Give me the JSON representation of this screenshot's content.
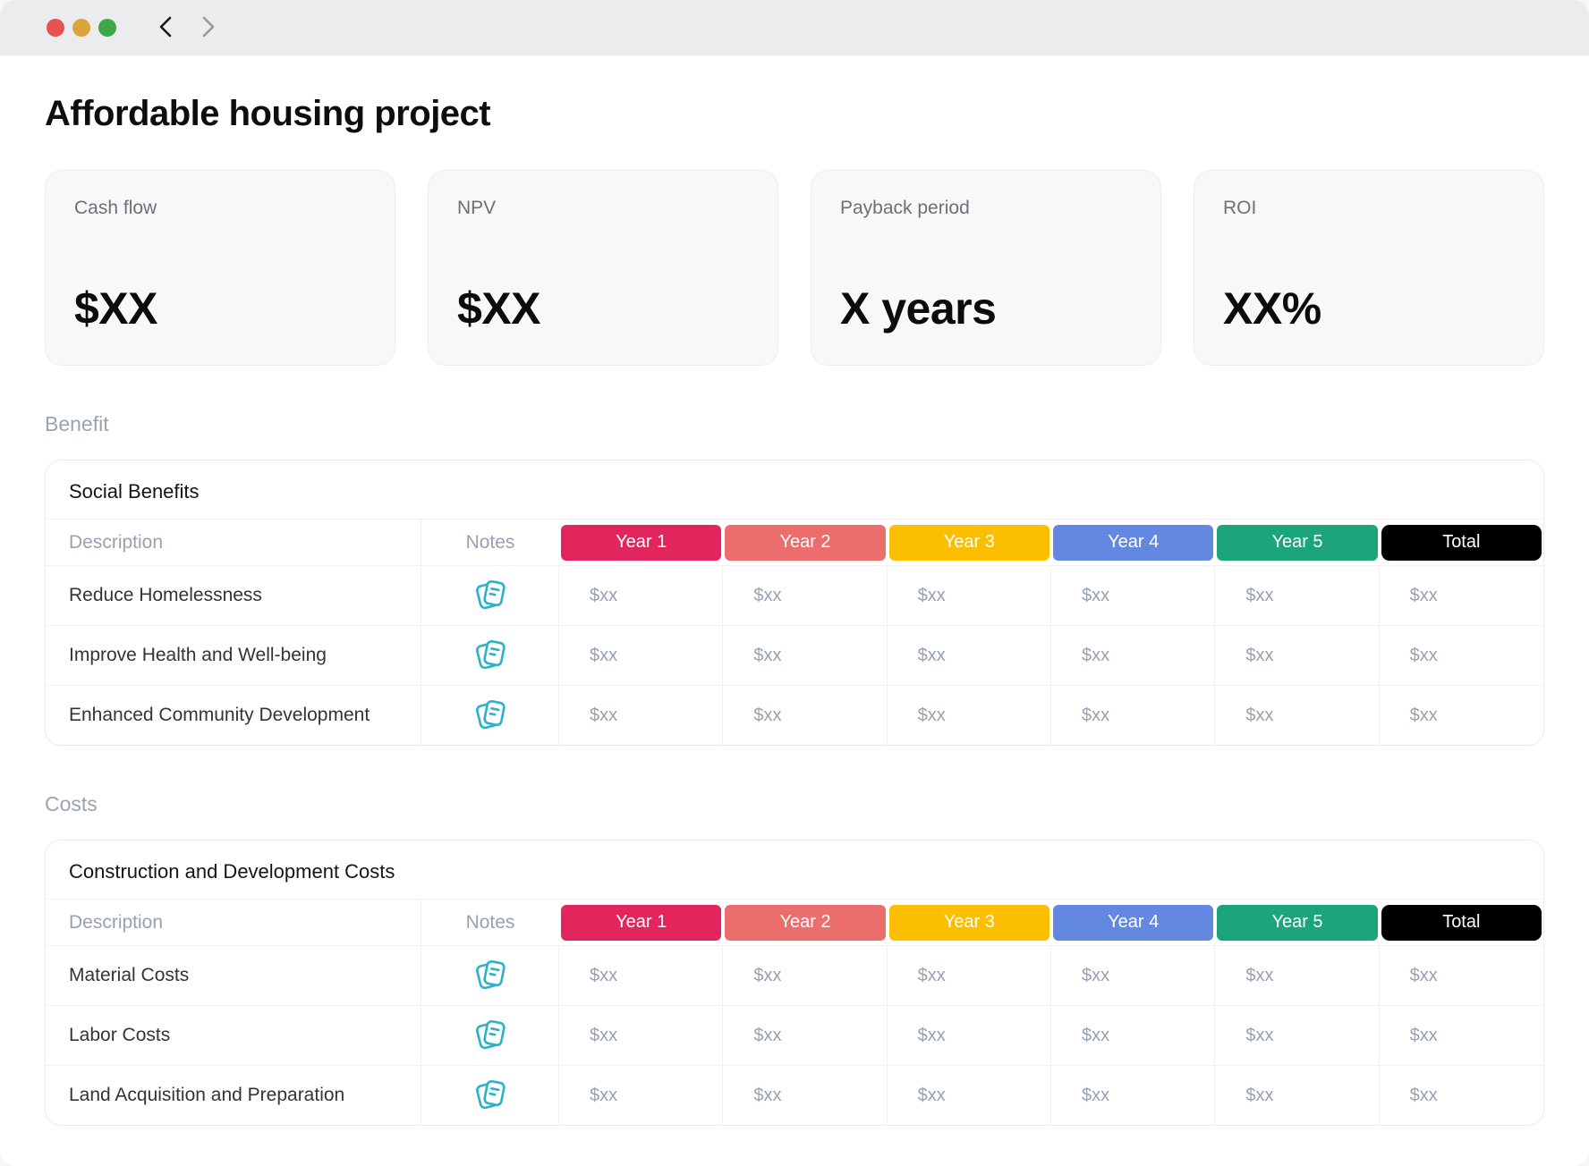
{
  "window": {
    "traffic_lights": [
      {
        "name": "close",
        "color": "#e5534e"
      },
      {
        "name": "minimize",
        "color": "#dba53d"
      },
      {
        "name": "zoom",
        "color": "#3da74a"
      }
    ],
    "nav": {
      "back_color": "#1a1a1c",
      "forward_color": "#98989d"
    }
  },
  "page": {
    "title": "Affordable housing project"
  },
  "kpis": [
    {
      "label": "Cash flow",
      "value": "$XX"
    },
    {
      "label": "NPV",
      "value": "$XX"
    },
    {
      "label": "Payback period",
      "value": "X years"
    },
    {
      "label": "ROI",
      "value": "XX%"
    }
  ],
  "columns": {
    "description": "Description",
    "notes": "Notes",
    "years": [
      {
        "label": "Year 1",
        "color": "#e2265d"
      },
      {
        "label": "Year 2",
        "color": "#ec6e6c"
      },
      {
        "label": "Year 3",
        "color": "#fcbf00"
      },
      {
        "label": "Year 4",
        "color": "#6288e2"
      },
      {
        "label": "Year 5",
        "color": "#1ca57d"
      }
    ],
    "total": {
      "label": "Total",
      "color": "#000000"
    }
  },
  "icons": {
    "notes_color": "#2bb2c6"
  },
  "sections": [
    {
      "label": "Benefit",
      "table_title": "Social Benefits",
      "rows": [
        {
          "description": "Reduce Homelessness",
          "values": [
            "$xx",
            "$xx",
            "$xx",
            "$xx",
            "$xx",
            "$xx"
          ]
        },
        {
          "description": "Improve Health and Well-being",
          "values": [
            "$xx",
            "$xx",
            "$xx",
            "$xx",
            "$xx",
            "$xx"
          ]
        },
        {
          "description": "Enhanced Community Development",
          "values": [
            "$xx",
            "$xx",
            "$xx",
            "$xx",
            "$xx",
            "$xx"
          ]
        }
      ]
    },
    {
      "label": "Costs",
      "table_title": "Construction and Development Costs",
      "rows": [
        {
          "description": "Material Costs",
          "values": [
            "$xx",
            "$xx",
            "$xx",
            "$xx",
            "$xx",
            "$xx"
          ]
        },
        {
          "description": "Labor Costs",
          "values": [
            "$xx",
            "$xx",
            "$xx",
            "$xx",
            "$xx",
            "$xx"
          ]
        },
        {
          "description": "Land Acquisition and Preparation",
          "values": [
            "$xx",
            "$xx",
            "$xx",
            "$xx",
            "$xx",
            "$xx"
          ]
        }
      ]
    }
  ]
}
